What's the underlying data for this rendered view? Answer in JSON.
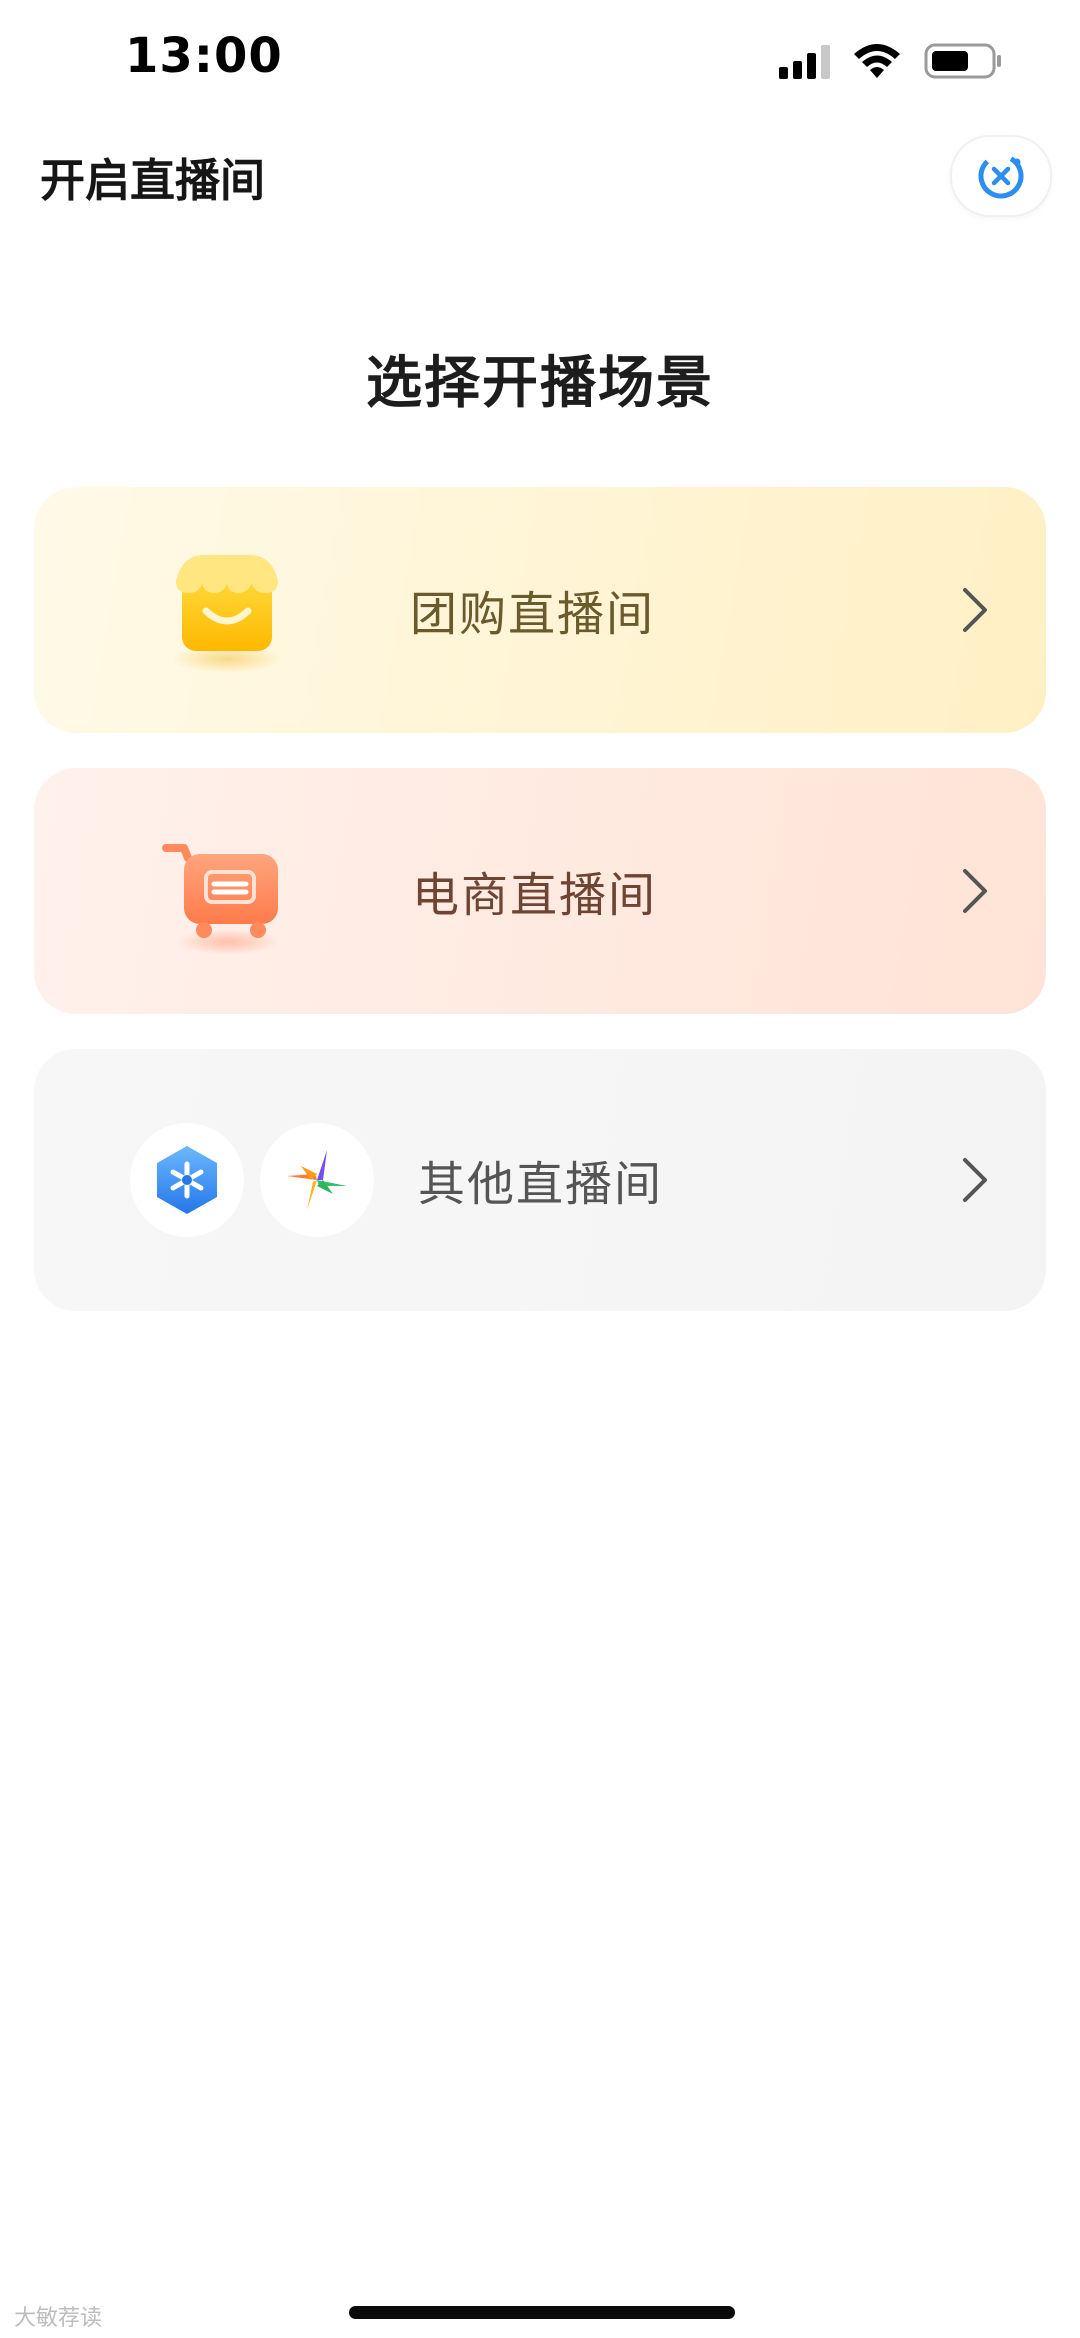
{
  "status_bar": {
    "time": "13:00",
    "icons": [
      "signal-icon",
      "wifi-icon",
      "battery-icon"
    ]
  },
  "header": {
    "title": "开启直播间",
    "close_icon": "close-circle-icon"
  },
  "main": {
    "heading": "选择开播场景",
    "cards": [
      {
        "label": "团购直播间",
        "icon": "store-icon"
      },
      {
        "label": "电商直播间",
        "icon": "shopping-cart-icon"
      },
      {
        "label": "其他直播间",
        "icons": [
          "snowflake-app-icon",
          "pinwheel-app-icon"
        ]
      }
    ]
  },
  "watermark": "大敏荐读",
  "colors": {
    "groupbuy_card": "#fff4d4",
    "ecommerce_card": "#ffe9df",
    "other_card": "#f5f5f5",
    "accent_blue": "#2b8ef0"
  }
}
